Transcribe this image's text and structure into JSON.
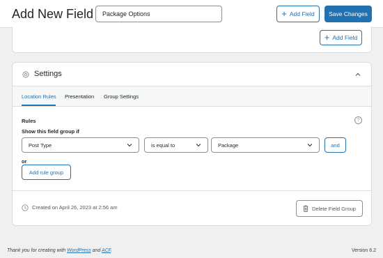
{
  "header": {
    "title": "Add New Field Group",
    "field_group_name": "Package Options",
    "add_field_label": "Add Field",
    "save_label": "Save Changes"
  },
  "fields_box": {
    "add_field_label": "Add Field"
  },
  "settings": {
    "title": "Settings",
    "tabs": [
      {
        "label": "Location Rules",
        "active": true
      },
      {
        "label": "Presentation",
        "active": false
      },
      {
        "label": "Group Settings",
        "active": false
      }
    ],
    "rules_label": "Rules",
    "help_icon": "?",
    "show_label": "Show this field group if",
    "rule": {
      "param": "Post Type",
      "operator": "is equal to",
      "value": "Package",
      "and_label": "and"
    },
    "or_label": "or",
    "add_rule_group_label": "Add rule group",
    "created_text": "Created on April 26, 2023 at 2:56 am",
    "delete_label": "Delete Field Group"
  },
  "footer": {
    "thanks_prefix": "Thank you for creating with",
    "wordpress_link": "WordPress",
    "and_text": "and",
    "acf_link": "ACF",
    "period": ".",
    "version": "Version 6.2"
  },
  "colors": {
    "accent": "#2271b1",
    "background": "#f0f0f1",
    "border": "#dcdcde"
  },
  "icons": {
    "settings": "gear-icon",
    "collapse": "chevron-up-icon",
    "help": "help-icon",
    "created": "clock-icon",
    "delete": "trash-icon"
  }
}
